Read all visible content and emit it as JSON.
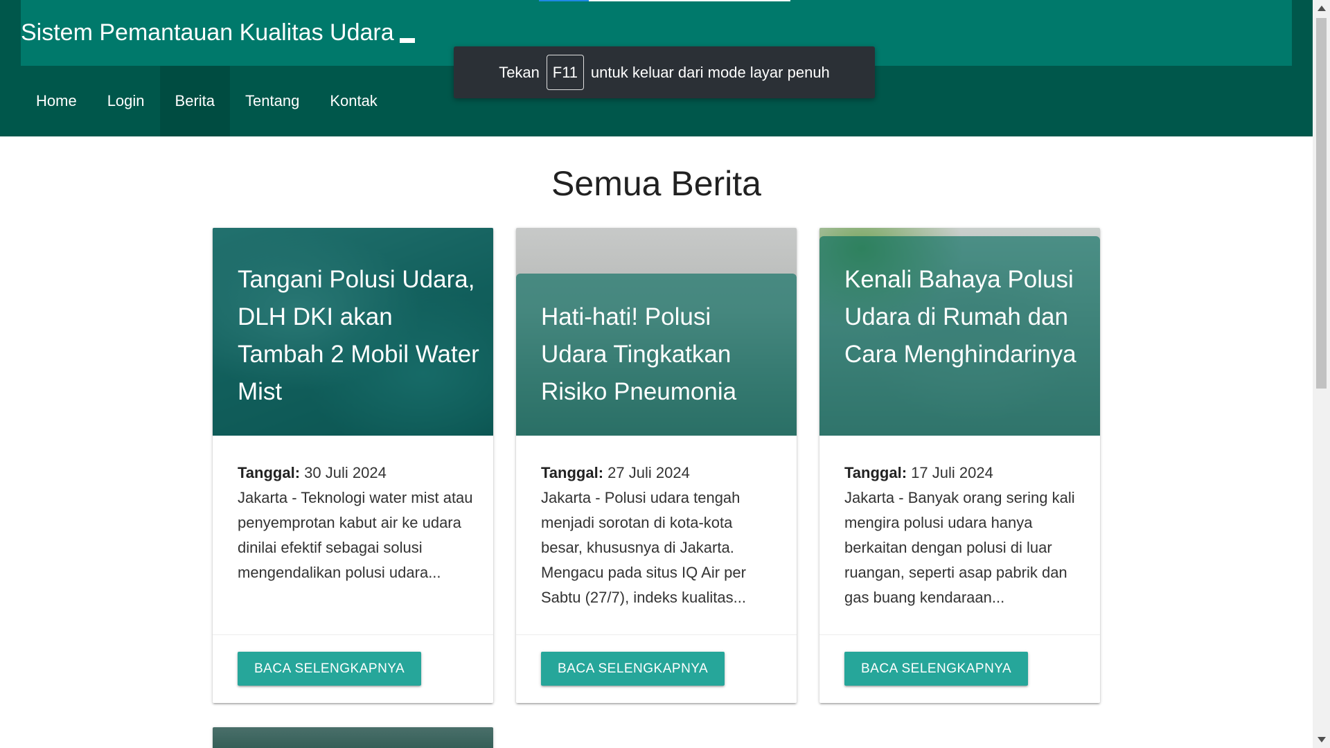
{
  "header": {
    "site_title": "Sistem Pemantauan Kualitas Udara",
    "nav": [
      {
        "label": "Home",
        "active": false
      },
      {
        "label": "Login",
        "active": false
      },
      {
        "label": "Berita",
        "active": true
      },
      {
        "label": "Tentang",
        "active": false
      },
      {
        "label": "Kontak",
        "active": false
      }
    ]
  },
  "fullscreen_notice": {
    "prefix": "Tekan",
    "key": "F11",
    "suffix": "untuk keluar dari mode layar penuh"
  },
  "main": {
    "heading": "Semua Berita",
    "cards": [
      {
        "title": "Tangani Polusi Udara, DLH DKI akan Tambah 2 Mobil Water Mist",
        "date_label": "Tanggal:",
        "date": "30 Juli 2024",
        "summary": "Jakarta - Teknologi water mist atau penyemprotan kabut air ke udara dinilai efektif sebagai solusi mengendalikan polusi udara...",
        "button": "Baca Selengkapnya"
      },
      {
        "title": "Hati-hati! Polusi Udara Tingkatkan Risiko Pneumonia",
        "date_label": "Tanggal:",
        "date": "27 Juli 2024",
        "summary": "Jakarta - Polusi udara tengah menjadi sorotan di kota-kota besar, khususnya di Jakarta. Mengacu pada situs IQ Air per Sabtu (27/7), indeks kualitas...",
        "button": "Baca Selengkapnya"
      },
      {
        "title": "Kenali Bahaya Polusi Udara di Rumah dan Cara Menghindarinya",
        "date_label": "Tanggal:",
        "date": "17 Juli 2024",
        "summary": "Jakarta - Banyak orang sering kali mengira polusi udara hanya berkaitan dengan polusi di luar ruangan, seperti asap pabrik dan gas buang kendaraan...",
        "button": "Baca Selengkapnya"
      }
    ]
  },
  "colors": {
    "nav_bg": "#00574b",
    "title_bar_bg": "#00796b",
    "button_bg": "#26a69a",
    "overlay": "#00695c"
  }
}
